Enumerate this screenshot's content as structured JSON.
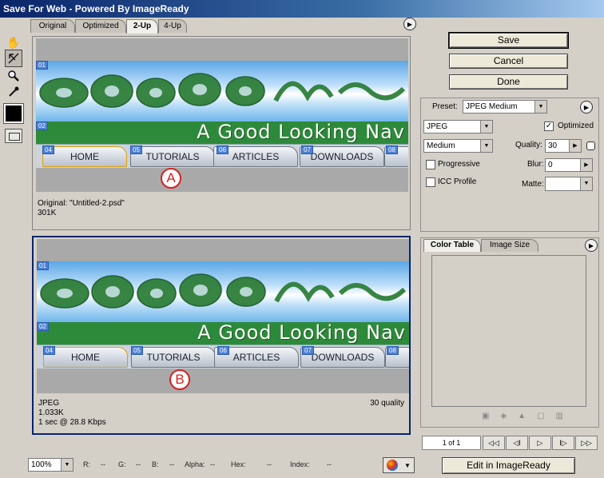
{
  "window": {
    "title": "Save For Web - Powered By ImageReady"
  },
  "tools": [
    "hand-icon",
    "slice-select-icon",
    "zoom-icon",
    "eyedropper-icon"
  ],
  "tabs": [
    {
      "label": "Original",
      "active": false
    },
    {
      "label": "Optimized",
      "active": false
    },
    {
      "label": "2-Up",
      "active": true
    },
    {
      "label": "4-Up",
      "active": false
    }
  ],
  "banner": {
    "nav_text": "A Good Looking Nav",
    "buttons": [
      "HOME",
      "TUTORIALS",
      "ARTICLES",
      "DOWNLOADS"
    ],
    "slices_top": [
      "01",
      "02"
    ],
    "slices_row": [
      "04",
      "05",
      "06",
      "07",
      "08"
    ]
  },
  "pane_a": {
    "marker": "A",
    "info_line1": "Original: \"Untitled-2.psd\"",
    "info_line2": "301K"
  },
  "pane_b": {
    "marker": "B",
    "info_line1": "JPEG",
    "info_line2": "1.033K",
    "info_line3": "1 sec @ 28.8 Kbps",
    "quality_text": "30 quality"
  },
  "actions": {
    "save": "Save",
    "cancel": "Cancel",
    "done": "Done"
  },
  "settings": {
    "preset_label": "Preset:",
    "preset_value": "JPEG Medium",
    "format": "JPEG",
    "quality_level": "Medium",
    "optimized_label": "Optimized",
    "optimized_checked": true,
    "quality_label": "Quality:",
    "quality_value": "30",
    "progressive_label": "Progressive",
    "blur_label": "Blur:",
    "blur_value": "0",
    "icc_label": "ICC Profile",
    "matte_label": "Matte:",
    "matte_value": ""
  },
  "color_panel": {
    "tabs": [
      "Color Table",
      "Image Size"
    ],
    "active_tab": "Color Table"
  },
  "pager": {
    "text": "1 of 1",
    "buttons": [
      "◁◁",
      "◁I",
      "▷",
      "I▷",
      "▷▷"
    ]
  },
  "statusbar": {
    "zoom": "100%",
    "r_label": "R:",
    "r_value": "--",
    "g_label": "G:",
    "g_value": "--",
    "b_label": "B:",
    "b_value": "--",
    "alpha_label": "Alpha:",
    "alpha_value": "--",
    "hex_label": "Hex:",
    "hex_value": "--",
    "index_label": "Index:",
    "index_value": "--"
  },
  "edit_button": "Edit in ImageReady",
  "colors": {
    "title_bar": "#0a246a",
    "nav_green": "#2d8a3a",
    "marker_red": "#d92020",
    "selected_pane": "#0a246a"
  }
}
